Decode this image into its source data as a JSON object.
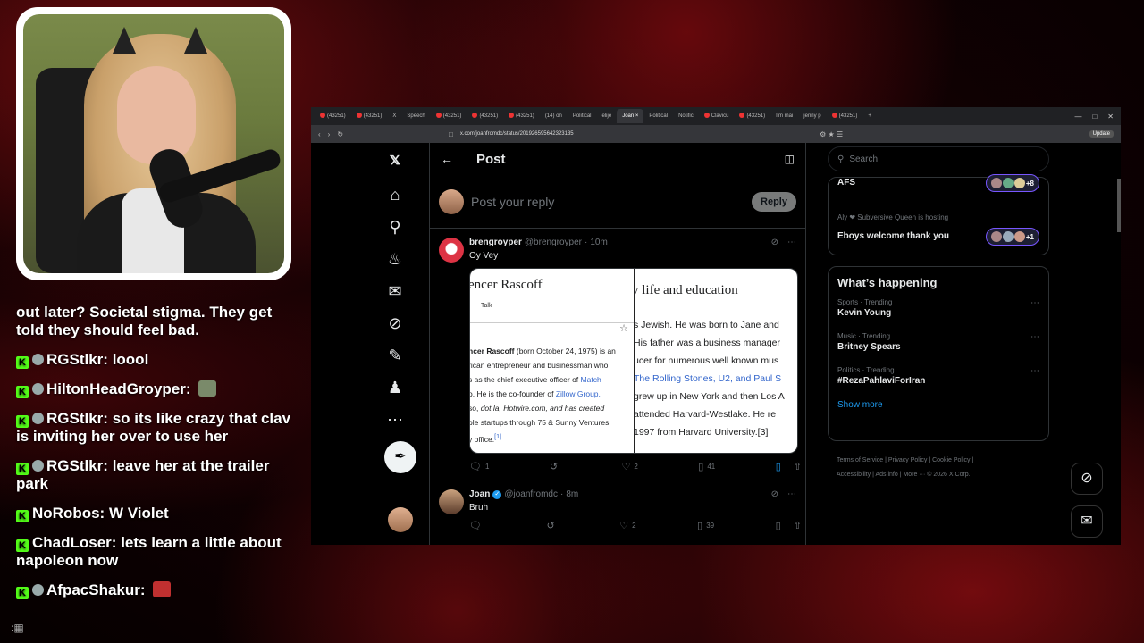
{
  "chat": {
    "messages": [
      {
        "user": "",
        "text": "out later? Societal stigma. They get told they should feel bad."
      },
      {
        "user": "RGStlkr",
        "text": "loool"
      },
      {
        "user": "HiltonHeadGroyper",
        "text": ""
      },
      {
        "user": "RGStlkr",
        "text": "so its like crazy that clav is inviting her over to use her"
      },
      {
        "user": "RGStlkr",
        "text": "leave her at the trailer park"
      },
      {
        "user": "NoRobos",
        "text": "W Violet"
      },
      {
        "user": "ChadLoser",
        "text": "lets learn a little about napoleon now"
      },
      {
        "user": "AfpacShakur",
        "text": ""
      }
    ],
    "badge_letter": "K"
  },
  "browser": {
    "tabs": [
      "(43251)",
      "(43251)",
      "X",
      "Speech",
      "(43251)",
      "(43251)",
      "(43251)",
      "(14) on",
      "Political",
      "elije",
      "Joan",
      "Political",
      "Notific",
      "Clavicu",
      "(43251)",
      "I'm mai",
      "jenny p",
      "(43251)"
    ],
    "active_tab_index": 10,
    "new_tab": "+",
    "url": "x.com/joanfromdc/status/201926595642323135",
    "update_label": "Update"
  },
  "x": {
    "header_title": "Post",
    "reply_placeholder": "Post your reply",
    "reply_button": "Reply",
    "tweets": [
      {
        "name": "brengroyper",
        "handle": "@brengroyper",
        "time": "10m",
        "verified": false,
        "text": "Oy Vey",
        "replies": "1",
        "reposts": "",
        "likes": "2",
        "views": "41"
      },
      {
        "name": "Joan",
        "handle": "@joanfromdc",
        "time": "8m",
        "verified": true,
        "text": "Bruh",
        "replies": "",
        "reposts": "",
        "likes": "2",
        "views": "39"
      }
    ],
    "media": {
      "left_title": "encer Rascoff",
      "left_talk": "Talk",
      "left_lines": [
        [
          "",
          "ncer Rascoff",
          " (born October 24, 1975) is an"
        ],
        [
          "",
          "rican entrepreneur and businessman who",
          ""
        ],
        [
          "",
          "s as the chief executive officer of ",
          "Match"
        ],
        [
          "",
          "o. He is the co-founder of ",
          "Zillow Group,"
        ],
        [
          "",
          "so, ",
          "dot.la, Hotwire.com, and has created"
        ],
        [
          "",
          "ble startups through 75 & Sunny Ventures,",
          ""
        ],
        [
          "",
          "y office.",
          "[1]"
        ]
      ],
      "right_title": "y life and education",
      "right_lines": [
        "s Jewish. He was born to Jane and",
        "His father was a business manager",
        "ucer for numerous well known mus",
        "The Rolling Stones, U2, and Paul S",
        "grew up in New York and then Los A",
        "attended Harvard-Westlake. He re",
        "1997 from Harvard University.[3]"
      ]
    },
    "search_placeholder": "Search",
    "spaces": [
      {
        "title": "AFS",
        "host": "",
        "extra": "+8"
      },
      {
        "title": "Eboys welcome thank you",
        "host": "Aly ❤ Subversive Queen is hosting",
        "extra": "+1"
      }
    ],
    "happening_title": "What’s happening",
    "trends": [
      {
        "meta": "Sports · Trending",
        "name": "Kevin Young"
      },
      {
        "meta": "Music · Trending",
        "name": "Britney Spears"
      },
      {
        "meta": "Politics · Trending",
        "name": "#RezaPahlaviForIran"
      }
    ],
    "show_more": "Show more",
    "footer_line1": "Terms of Service  |  Privacy Policy  |  Cookie Policy  |",
    "footer_line2": "Accessibility  |  Ads info  |  More ···  © 2026 X Corp."
  },
  "colors": {
    "accent": "#1d9bf0",
    "kick_green": "#53fc18",
    "bg_red": "#8b0a0e"
  }
}
